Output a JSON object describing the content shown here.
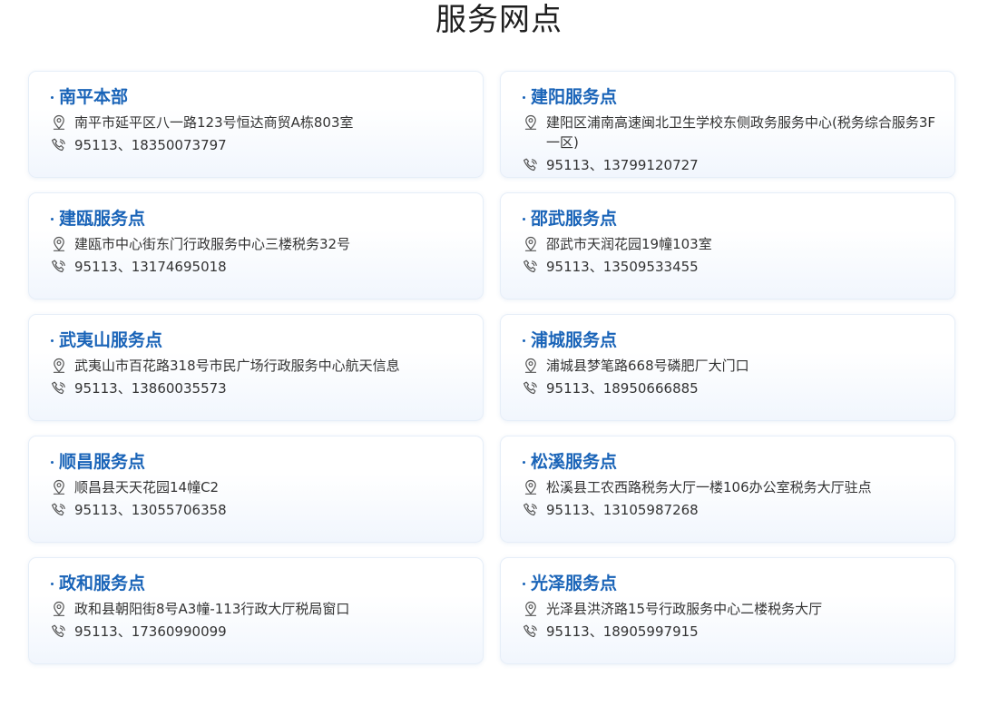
{
  "page": {
    "title": "服务网点"
  },
  "icons": {
    "address": "location-pin-icon",
    "phone": "phone-call-icon",
    "icon_color": "#555555",
    "title_color": "#1a64b8"
  },
  "service_points": [
    {
      "name": "南平本部",
      "address": "南平市延平区八一路123号恒达商贸A栋803室",
      "phone": "95113、18350073797"
    },
    {
      "name": "建阳服务点",
      "address": "建阳区浦南高速闽北卫生学校东侧政务服务中心(税务综合服务3F一区)",
      "phone": "95113、13799120727"
    },
    {
      "name": "建瓯服务点",
      "address": "建瓯市中心街东门行政服务中心三楼税务32号",
      "phone": "95113、13174695018"
    },
    {
      "name": "邵武服务点",
      "address": "邵武市天润花园19幢103室",
      "phone": "95113、13509533455"
    },
    {
      "name": "武夷山服务点",
      "address": "武夷山市百花路318号市民广场行政服务中心航天信息",
      "phone": "95113、13860035573"
    },
    {
      "name": "浦城服务点",
      "address": "浦城县梦笔路668号磷肥厂大门口",
      "phone": "95113、18950666885"
    },
    {
      "name": "顺昌服务点",
      "address": "顺昌县天天花园14幢C2",
      "phone": "95113、13055706358"
    },
    {
      "name": "松溪服务点",
      "address": "松溪县工农西路税务大厅一楼106办公室税务大厅驻点",
      "phone": "95113、13105987268"
    },
    {
      "name": "政和服务点",
      "address": "政和县朝阳街8号A3幢-113行政大厅税局窗口",
      "phone": "95113、17360990099"
    },
    {
      "name": "光泽服务点",
      "address": "光泽县洪济路15号行政服务中心二楼税务大厅",
      "phone": "95113、18905997915"
    }
  ]
}
